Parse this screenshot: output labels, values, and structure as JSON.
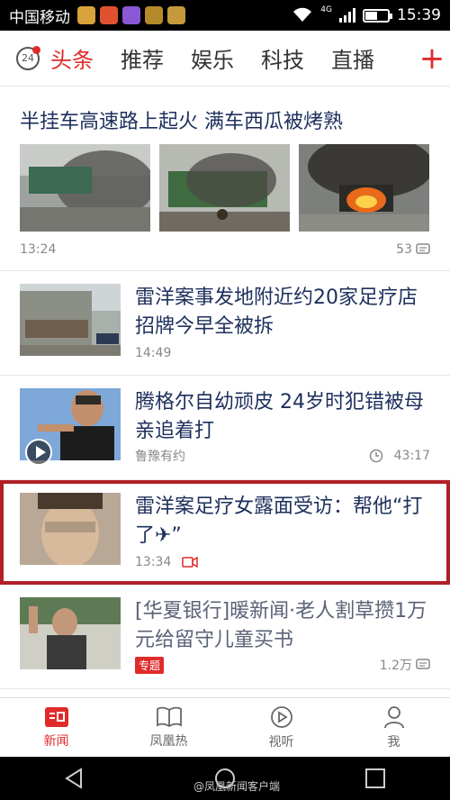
{
  "status_bar": {
    "carrier": "中国移动",
    "network": "4G",
    "time": "15:39",
    "app_icons": [
      {
        "name": "app-icon-1",
        "color": "#d8a33a"
      },
      {
        "name": "app-icon-2",
        "color": "#e0522f"
      },
      {
        "name": "app-icon-3",
        "color": "#8a58d6"
      },
      {
        "name": "app-icon-4",
        "color": "#b48a2b"
      },
      {
        "name": "app-icon-5",
        "color": "#c69a3c"
      }
    ]
  },
  "channel_bar": {
    "weather_badge": "24",
    "tabs": [
      {
        "label": "头条",
        "active": true
      },
      {
        "label": "推荐"
      },
      {
        "label": "娱乐"
      },
      {
        "label": "科技"
      },
      {
        "label": "直播"
      }
    ],
    "add_label": "+"
  },
  "articles": [
    {
      "title": "半挂车高速路上起火 满车西瓜被烤熟",
      "time": "13:24",
      "comments": "53"
    },
    {
      "title": "雷洋案事发地附近约20家足疗店招牌今早全被拆",
      "time": "14:49"
    },
    {
      "title": "腾格尔自幼顽皮 24岁时犯错被母亲追着打",
      "source": "鲁豫有约",
      "duration": "43:17"
    },
    {
      "title": "雷洋案足疗女露面受访：帮他“打了✈”",
      "time": "13:34",
      "highlighted": true
    },
    {
      "title": "[华夏银行]暖新闻·老人割草攒1万元给留守儿童买书",
      "tag": "专题",
      "views": "1.2万"
    }
  ],
  "bottom_nav": [
    {
      "label": "新闻",
      "active": true
    },
    {
      "label": "凤凰热"
    },
    {
      "label": "视听"
    },
    {
      "label": "我"
    }
  ],
  "watermark": "@凤凰新闻客户端",
  "colors": {
    "accent": "#e02b2b",
    "title": "#1d2f5c",
    "highlight_border": "#b02026"
  }
}
